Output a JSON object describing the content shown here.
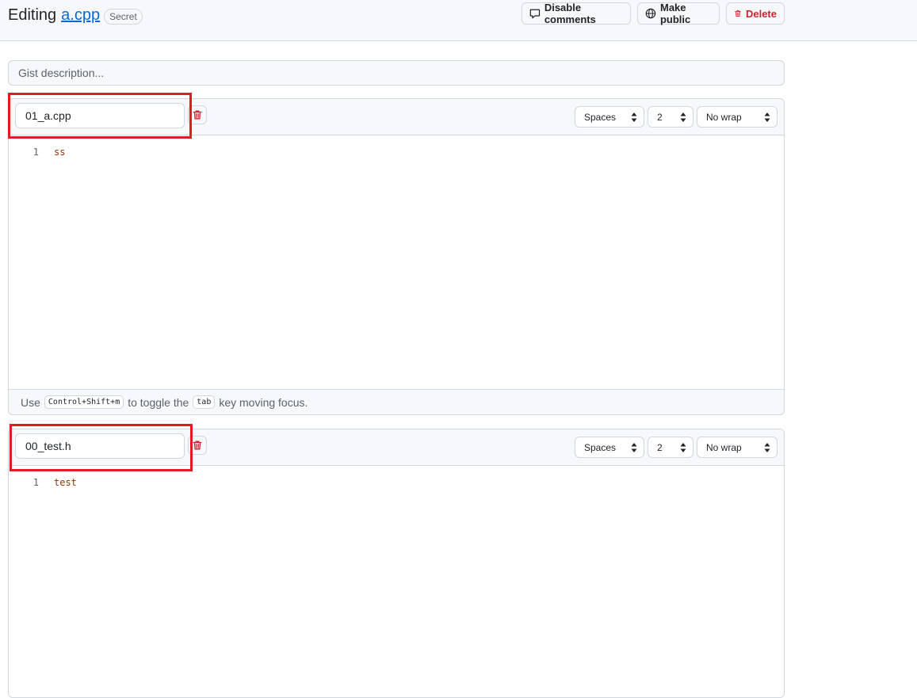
{
  "header": {
    "title_prefix": "Editing",
    "title_file": "a.cpp",
    "badge": "Secret",
    "buttons": {
      "disable_comments": "Disable comments",
      "make_public": "Make public",
      "delete": "Delete"
    }
  },
  "gist_description": {
    "placeholder": "Gist description...",
    "value": ""
  },
  "files": [
    {
      "filename": "01_a.cpp",
      "indent_mode": "Spaces",
      "indent_size": "2",
      "wrap_mode": "No wrap",
      "lines": [
        {
          "number": "1",
          "text": "ss"
        }
      ],
      "footer": {
        "use": "Use",
        "shortcut": "Control+Shift+m",
        "toggle_the": "to toggle the",
        "tab_key": "tab",
        "moving_focus": "key moving focus."
      }
    },
    {
      "filename": "00_test.h",
      "indent_mode": "Spaces",
      "indent_size": "2",
      "wrap_mode": "No wrap",
      "lines": [
        {
          "number": "1",
          "text": "test"
        }
      ]
    }
  ],
  "colors": {
    "accent_link": "#0969da",
    "danger": "#cf222e",
    "highlight": "#e01b24",
    "code_text": "#953800"
  },
  "icons": {
    "disable_comments": "comment-icon",
    "make_public": "globe-icon",
    "delete": "trash-icon",
    "remove_file": "trash-icon",
    "select_arrows": "up-down-arrows-icon"
  }
}
